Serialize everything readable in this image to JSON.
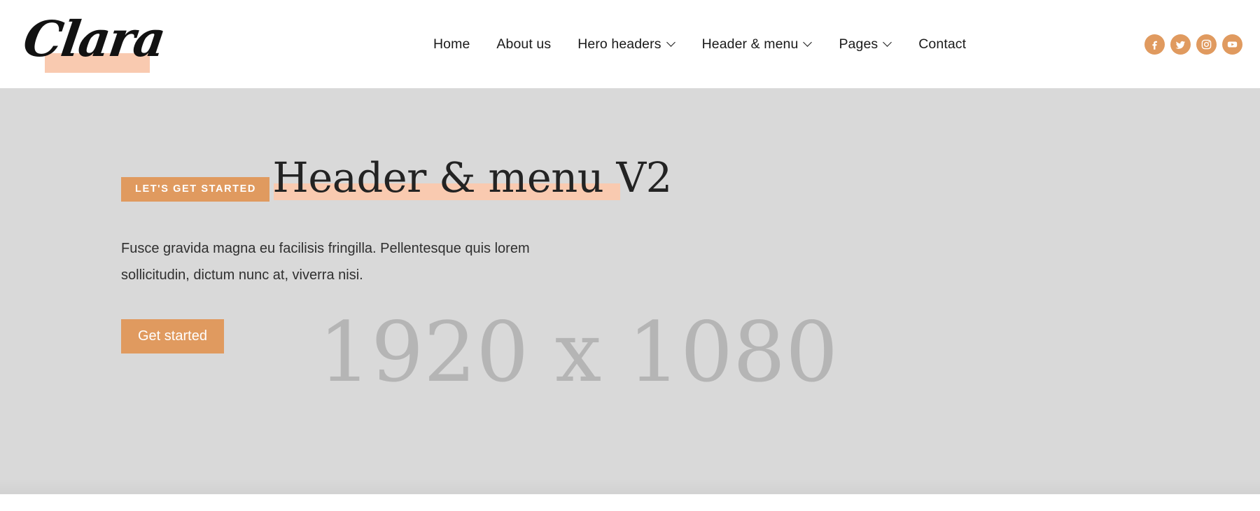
{
  "header": {
    "brand": {
      "name": "Clara",
      "underline_color": "#f9cab0"
    },
    "nav_items": [
      {
        "label": "Home",
        "has_dropdown": false
      },
      {
        "label": "About us",
        "has_dropdown": false
      },
      {
        "label": "Hero headers",
        "has_dropdown": true
      },
      {
        "label": "Header & menu",
        "has_dropdown": true
      },
      {
        "label": "Pages",
        "has_dropdown": true
      },
      {
        "label": "Contact",
        "has_dropdown": false
      }
    ],
    "social_links": [
      {
        "name": "facebook",
        "title": "Facebook"
      },
      {
        "name": "twitter",
        "title": "Twitter"
      },
      {
        "name": "instagram",
        "title": "Instagram"
      },
      {
        "name": "youtube",
        "title": "YouTube"
      }
    ]
  },
  "hero": {
    "placeholder_text": "1920 x 1080",
    "eyebrow": "LET'S GET STARTED",
    "title": "Header & menu V2",
    "paragraph": "Fusce gravida magna eu facilisis fringilla. Pellentesque quis lorem sollicitudin, dictum nunc at, viverra nisi.",
    "cta_label": "Get started",
    "background_color": "#d9d9d9"
  },
  "colors": {
    "accent": "#e09a5f",
    "highlight": "#f9cab0",
    "text_dark": "#1a1a1a",
    "placeholder_gray": "#b5b5b5"
  }
}
